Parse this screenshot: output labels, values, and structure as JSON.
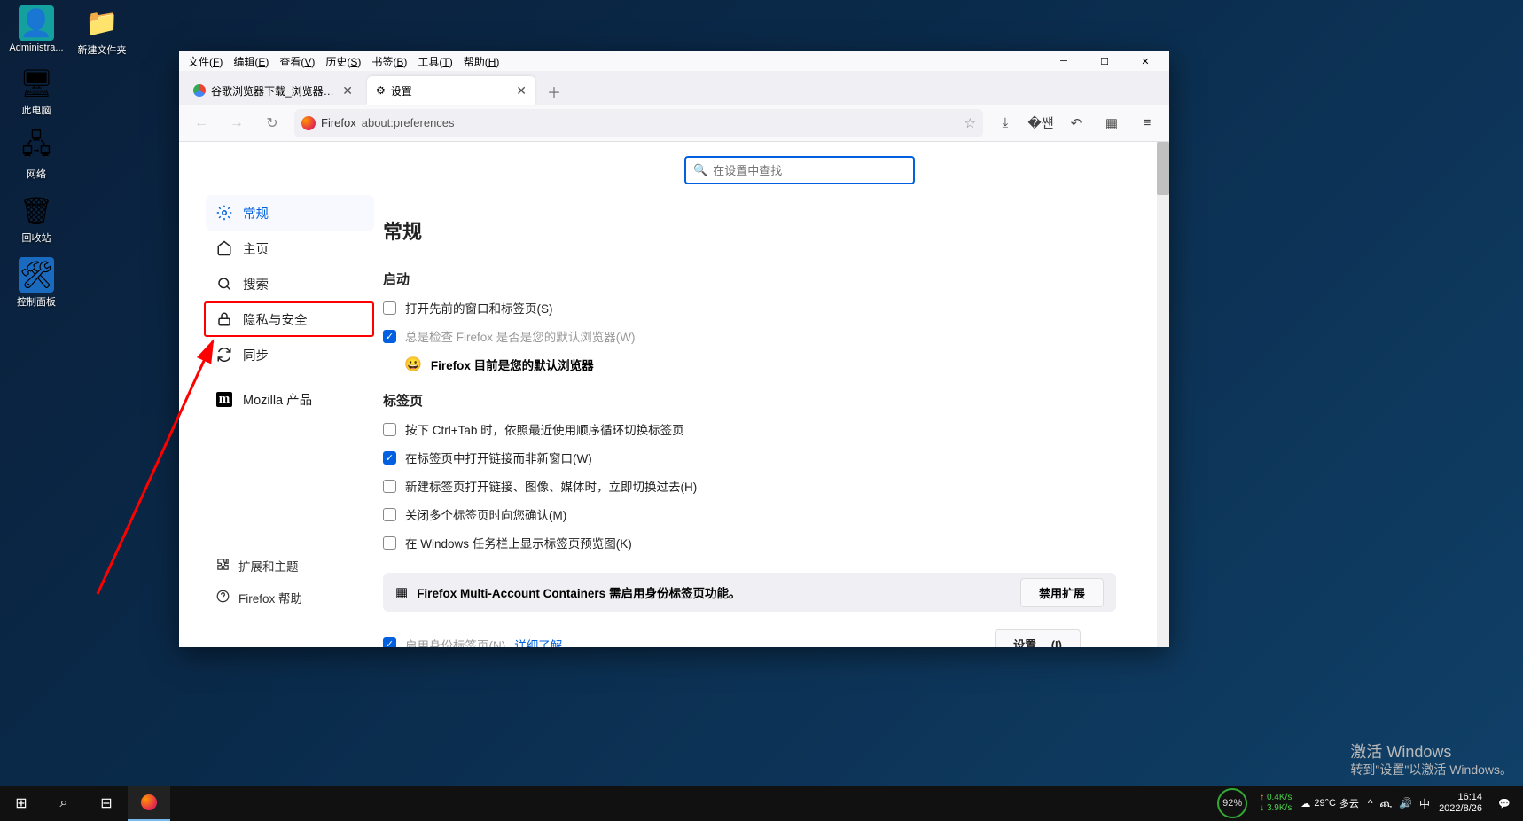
{
  "desktop": {
    "icons_col1": [
      {
        "name": "admin",
        "label": "Administra...",
        "emoji": "👤",
        "bg": "#15a0a0"
      },
      {
        "name": "pc",
        "label": "此电脑",
        "emoji": "🖥",
        "bg": ""
      },
      {
        "name": "net",
        "label": "网络",
        "emoji": "🖧",
        "bg": ""
      },
      {
        "name": "recycle",
        "label": "回收站",
        "emoji": "🗑",
        "bg": ""
      },
      {
        "name": "cpanel",
        "label": "控制面板",
        "emoji": "🛠",
        "bg": "#1a6bbf"
      }
    ],
    "icons_col2": [
      {
        "name": "folder",
        "label": "新建文件夹",
        "emoji": "📁",
        "bg": ""
      }
    ]
  },
  "menubar": [
    "文件(F)",
    "编辑(E)",
    "查看(V)",
    "历史(S)",
    "书签(B)",
    "工具(T)",
    "帮助(H)"
  ],
  "tabs": [
    {
      "title": "谷歌浏览器下载_浏览器官网入口",
      "icon": "chrome",
      "active": false
    },
    {
      "title": "设置",
      "icon": "gear",
      "active": true
    }
  ],
  "addr": {
    "app": "Firefox",
    "url": "about:preferences"
  },
  "search_ph": "在设置中查找",
  "cats": [
    {
      "id": "general",
      "label": "常规",
      "icon": "gear",
      "sel": true
    },
    {
      "id": "home",
      "label": "主页",
      "icon": "home"
    },
    {
      "id": "search",
      "label": "搜索",
      "icon": "search"
    },
    {
      "id": "privacy",
      "label": "隐私与安全",
      "icon": "lock",
      "hl": true
    },
    {
      "id": "sync",
      "label": "同步",
      "icon": "sync"
    },
    {
      "id": "more",
      "label": "Mozilla 产品",
      "icon": "moz"
    }
  ],
  "side_links": [
    {
      "id": "ext",
      "label": "扩展和主题",
      "icon": "puzzle"
    },
    {
      "id": "help",
      "label": "Firefox 帮助",
      "icon": "help"
    }
  ],
  "content": {
    "h1": "常规",
    "startup": {
      "h": "启动",
      "c1": "打开先前的窗口和标签页(S)",
      "c2": "总是检查 Firefox 是否是您的默认浏览器(W)",
      "def": "Firefox 目前是您的默认浏览器"
    },
    "tabs": {
      "h": "标签页",
      "c1": "按下 Ctrl+Tab 时，依照最近使用顺序循环切换标签页",
      "c2": "在标签页中打开链接而非新窗口(W)",
      "c3": "新建标签页打开链接、图像、媒体时，立即切换过去(H)",
      "c4": "关闭多个标签页时向您确认(M)",
      "c5": "在 Windows 任务栏上显示标签页预览图(K)"
    },
    "ext": {
      "txt": "Firefox Multi-Account Containers 需启用身份标签页功能。",
      "btn": "禁用扩展"
    },
    "cut": {
      "txt": "启用身份标签页(N)",
      "link": "详细了解",
      "btn": "设置… (I)"
    }
  },
  "watermark": {
    "t": "激活 Windows",
    "s": "转到\"设置\"以激活 Windows。"
  },
  "taskbar": {
    "gauge": "92%",
    "up": "0.4K/s",
    "down": "3.9K/s",
    "weather": {
      "temp": "29°C",
      "desc": "多云"
    },
    "tray": [
      "^",
      "ጪ",
      "🔊",
      "中"
    ],
    "time": "16:14",
    "date": "2022/8/26"
  }
}
